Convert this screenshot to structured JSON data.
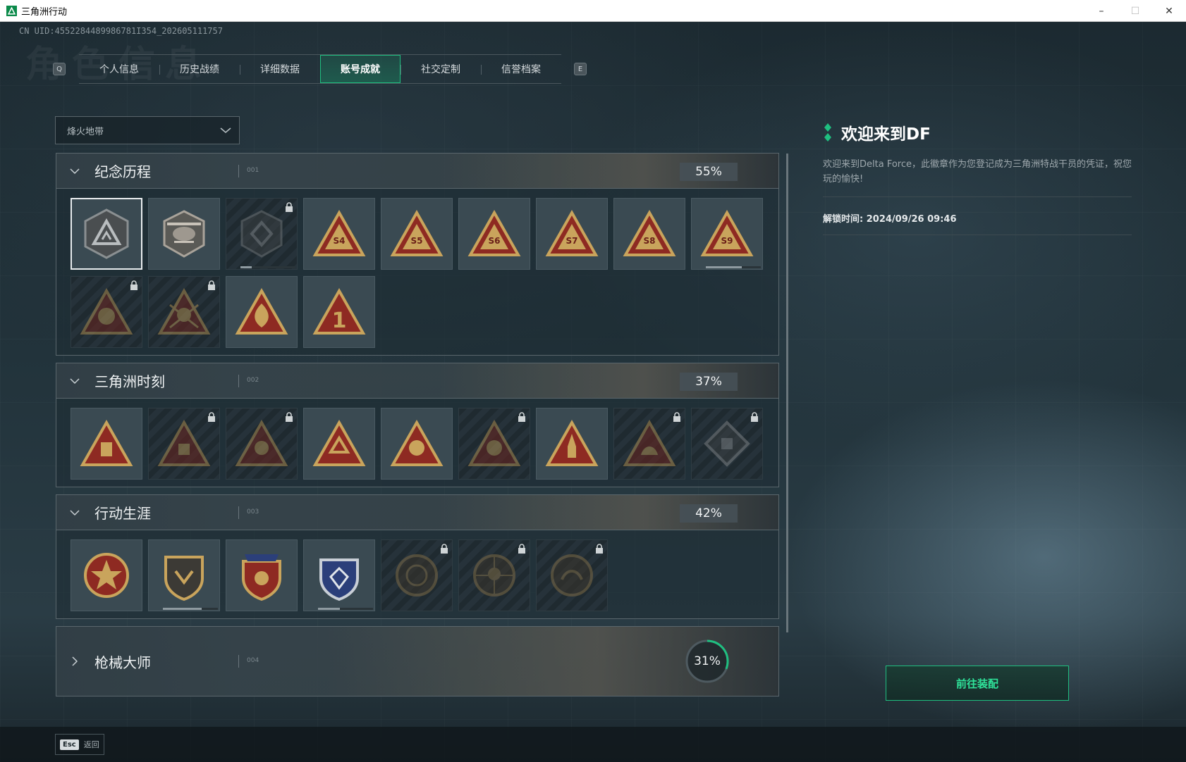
{
  "window": {
    "title": "三角洲行动",
    "minimize": "–",
    "maximize": "☐",
    "close": "✕"
  },
  "uid": "CN UID:4552284489986781I354_202605111757",
  "bg_title": "角色信息",
  "tabs": {
    "left_key": "Q",
    "right_key": "E",
    "items": [
      "个人信息",
      "历史战绩",
      "详细数据",
      "账号成就",
      "社交定制",
      "信誉档案"
    ],
    "active": "账号成就"
  },
  "dropdown": {
    "value": "烽火地带"
  },
  "sections": [
    {
      "title": "纪念历程",
      "num": "001",
      "percent": "55%"
    },
    {
      "title": "三角洲时刻",
      "num": "002",
      "percent": "37%"
    },
    {
      "title": "行动生涯",
      "num": "003",
      "percent": "42%"
    },
    {
      "title": "枪械大师",
      "num": "004",
      "percent": "31%",
      "percent_value": 0.31
    }
  ],
  "badge_labels": {
    "s4": "S4",
    "s5": "S5",
    "s6": "S6",
    "s7": "S7",
    "s8": "S8",
    "s9": "S9",
    "one": "1"
  },
  "detail": {
    "title": "欢迎来到DF",
    "desc": "欢迎来到Delta Force，此徽章作为您登记成为三角洲特战干员的凭证，祝您玩的愉快!",
    "unlock": "解锁时间: 2024/09/26 09:46",
    "button": "前往装配"
  },
  "footer": {
    "key": "Esc",
    "label": "返回"
  },
  "colors": {
    "accent": "#1fbf80",
    "gold": "#c9a45c",
    "red": "#8e2a22"
  }
}
